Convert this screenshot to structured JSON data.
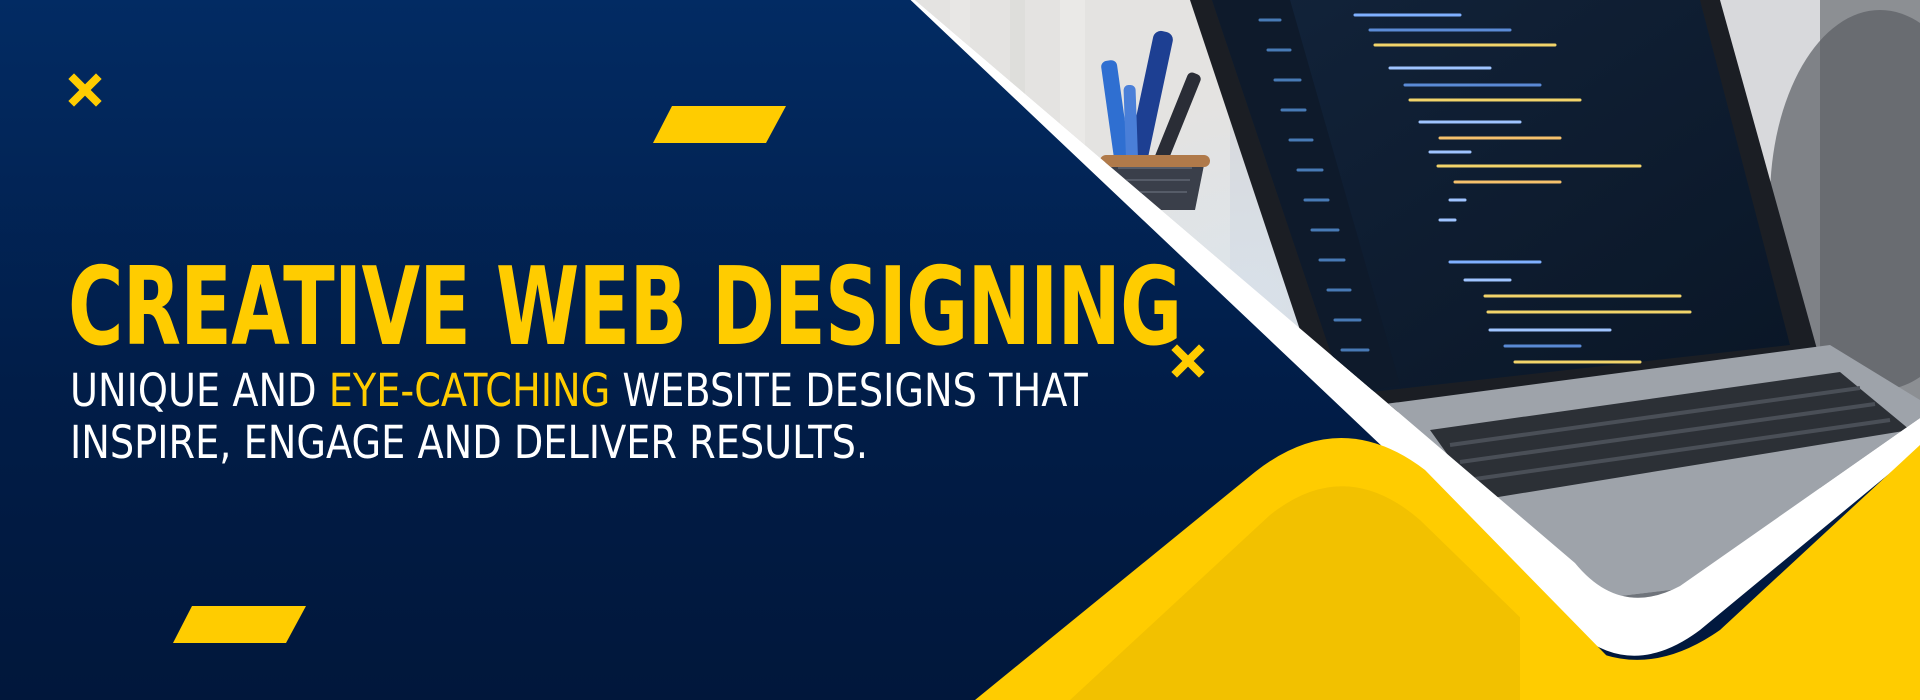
{
  "banner": {
    "headline": "CREATIVE WEB DESIGNING",
    "subtitle": {
      "line1_before": "UNIQUE AND ",
      "line1_highlight": "EYE-CATCHING",
      "line1_after": " WEBSITE DESIGNS THAT",
      "line2": "INSPIRE, ENGAGE AND DELIVER RESULTS."
    },
    "photo_subject": "laptop with code editor and pen holder",
    "icons": [
      "x-mark-icon",
      "x-mark-icon"
    ]
  },
  "colors": {
    "navy": "#022b63",
    "navy_dark": "#01173b",
    "yellow": "#ffcc00",
    "yellow_dark": "#f2c100",
    "white": "#ffffff"
  }
}
